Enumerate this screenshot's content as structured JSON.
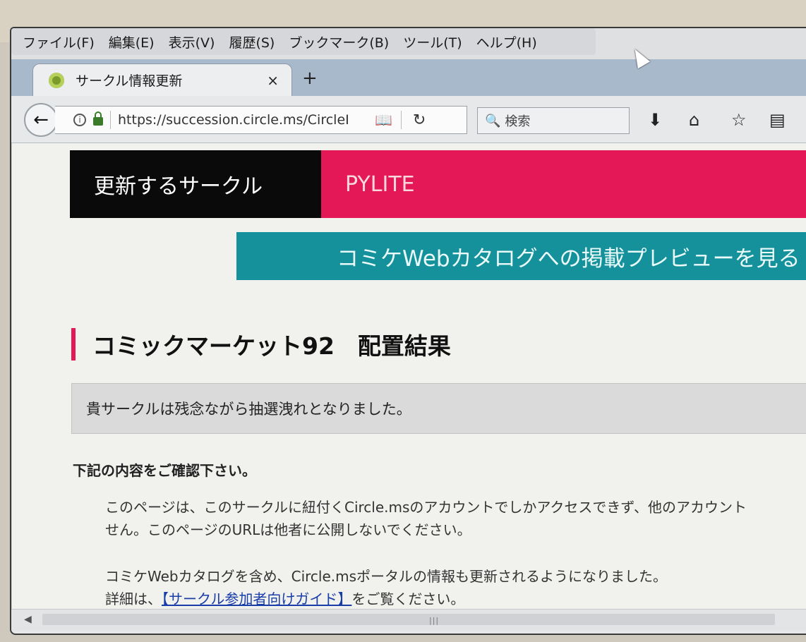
{
  "menubar": {
    "items": [
      "ファイル(F)",
      "編集(E)",
      "表示(V)",
      "履歴(S)",
      "ブックマーク(B)",
      "ツール(T)",
      "ヘルプ(H)"
    ]
  },
  "tab": {
    "title": "サークル情報更新",
    "close_label": "×",
    "new_tab_label": "+"
  },
  "navbar": {
    "url": "https://succession.circle.ms/CircleI",
    "search_placeholder": "検索"
  },
  "page": {
    "circle_label": "更新するサークル",
    "circle_name": "PYLITE",
    "preview_button": "コミケWebカタログへの掲載プレビューを見る",
    "section_heading": "コミックマーケット92　配置結果",
    "result_message": "貴サークルは残念ながら抽選洩れとなりました。",
    "notice_title": "下記の内容をご確認下さい。",
    "para1_line1": "このページは、このサークルに紐付くCircle.msのアカウントでしかアクセスできず、他のアカウント",
    "para1_line2": "せん。このページのURLは他者に公開しないでください。",
    "para2_line1": "コミケWebカタログを含め、Circle.msポータルの情報も更新されるようになりました。",
    "para2_line2_prefix": "詳細は、",
    "para2_link": "【サークル参加者向けガイド】",
    "para2_line2_suffix": "をご覧ください。"
  },
  "colors": {
    "circle_name_bg": "#e41856",
    "preview_button_bg": "#14919a",
    "heading_accent": "#e41856"
  }
}
